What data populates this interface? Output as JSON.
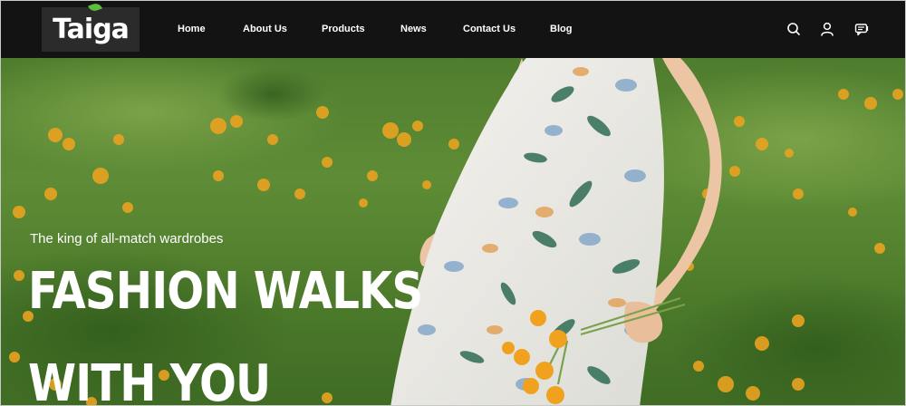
{
  "brand": {
    "logo_text": "Taiga"
  },
  "nav": {
    "items": [
      {
        "label": "Home"
      },
      {
        "label": "About Us"
      },
      {
        "label": "Products"
      },
      {
        "label": "News"
      },
      {
        "label": "Contact Us"
      },
      {
        "label": "Blog"
      }
    ],
    "icons": [
      "search-icon",
      "user-icon",
      "chat-icon"
    ]
  },
  "hero": {
    "tagline": "The king of all-match wardrobes",
    "headline_line1": "FASHION WALKS",
    "headline_line2": "WITH YOU"
  },
  "colors": {
    "nav_bg": "#131313",
    "logo_bg": "#2b2b2b",
    "accent_green": "#5bbf3a",
    "meadow_green": "#5e8c36",
    "flower_orange": "#e9a320"
  }
}
